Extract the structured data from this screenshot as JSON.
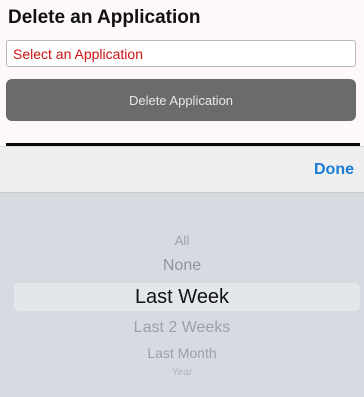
{
  "header": {
    "title": "Delete an Application"
  },
  "form": {
    "select_label": "Select an Application",
    "delete_label": "Delete Application"
  },
  "picker": {
    "done_label": "Done",
    "options": [
      "All",
      "None",
      "Last Week",
      "Last 2 Weeks",
      "Last Month",
      "Year"
    ],
    "selected_value": "Last Week"
  },
  "colors": {
    "select_text": "#cc1111",
    "delete_button_bg": "#6b6b6b",
    "done_text": "#1a7cd6",
    "wheel_bg": "#d6dbe1"
  }
}
